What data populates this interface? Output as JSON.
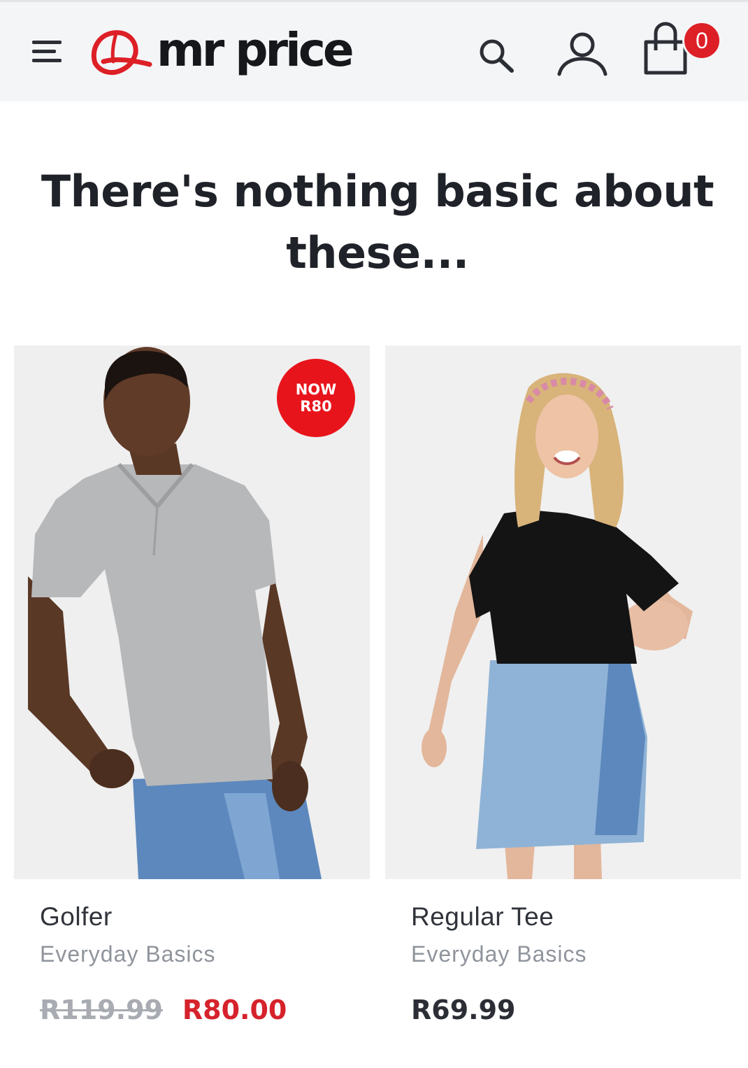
{
  "header": {
    "logo_text": "mr price",
    "cart_count": "0",
    "brand_color": "#dd1f26",
    "icons": [
      "menu-icon",
      "cap-logo-icon",
      "search-icon",
      "account-icon",
      "shopping-bag-icon"
    ]
  },
  "heading": "There's nothing basic about these...",
  "products": [
    {
      "badge_line1": "NOW",
      "badge_line2": "R80",
      "name": "Golfer",
      "category": "Everyday Basics",
      "was_price": "R119.99",
      "price": "R80.00"
    },
    {
      "name": "Regular Tee",
      "category": "Everyday Basics",
      "price": "R69.99"
    }
  ]
}
